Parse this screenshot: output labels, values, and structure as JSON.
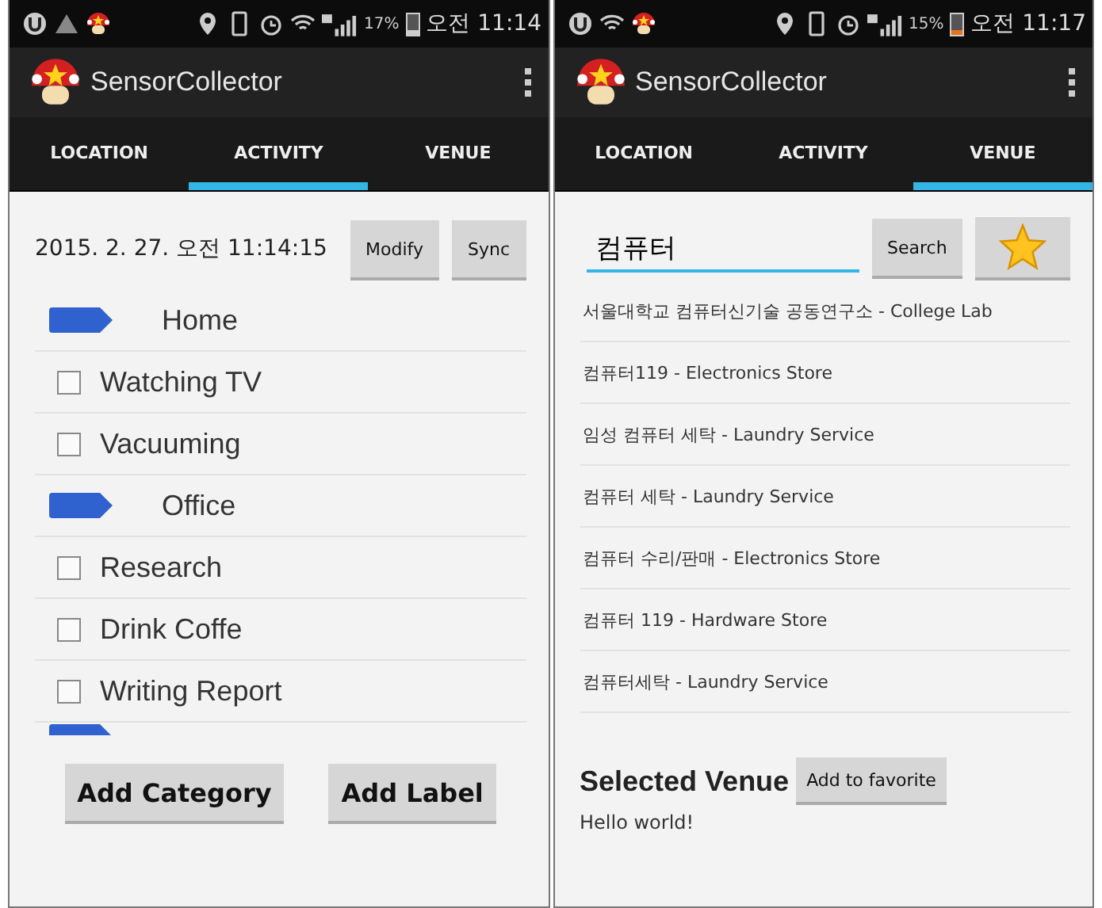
{
  "screens": [
    {
      "kind": "activity",
      "status_bar": {
        "battery": "17%",
        "time": "오전 11:14"
      },
      "app_title": "SensorCollector",
      "tabs": [
        {
          "label": "LOCATION",
          "selected": false
        },
        {
          "label": "ACTIVITY",
          "selected": true
        },
        {
          "label": "VENUE",
          "selected": false
        }
      ],
      "timestamp": "2015. 2. 27. 오전 11:14:15",
      "buttons": [
        "Modify",
        "Sync"
      ],
      "items": [
        {
          "kind": "category",
          "label": "Home"
        },
        {
          "kind": "label",
          "label": "Watching TV",
          "checked": false
        },
        {
          "kind": "label",
          "label": "Vacuuming",
          "checked": false
        },
        {
          "kind": "category",
          "label": "Office"
        },
        {
          "kind": "label",
          "label": "Research",
          "checked": false
        },
        {
          "kind": "label",
          "label": "Drink Coffe",
          "checked": false
        },
        {
          "kind": "label",
          "label": "Writing Report",
          "checked": false
        },
        {
          "kind": "category"
        }
      ],
      "bottom_buttons": [
        "Add Category",
        "Add Label"
      ]
    },
    {
      "kind": "venue",
      "status_bar": {
        "battery": "15%",
        "time": "오전 11:17"
      },
      "app_title": "SensorCollector",
      "tabs": [
        {
          "label": "LOCATION",
          "selected": false
        },
        {
          "label": "ACTIVITY",
          "selected": false
        },
        {
          "label": "VENUE",
          "selected": true
        }
      ],
      "search": {
        "value": "컴퓨터"
      },
      "search_button": "Search",
      "results": [
        "서울대학교 컴퓨터신기술 공동연구소 - College Lab",
        "컴퓨터119 - Electronics Store",
        "임성 컴퓨터 세탁 - Laundry Service",
        "컴퓨터 세탁 - Laundry Service",
        "컴퓨터 수리/판매 - Electronics Store",
        "컴퓨터 119 - Hardware Store",
        "컴퓨터세탁 - Laundry Service"
      ],
      "selected_venue_heading": "Selected Venue",
      "favorite_button": "Add to favorite",
      "selected_venue": "Hello world!"
    }
  ]
}
